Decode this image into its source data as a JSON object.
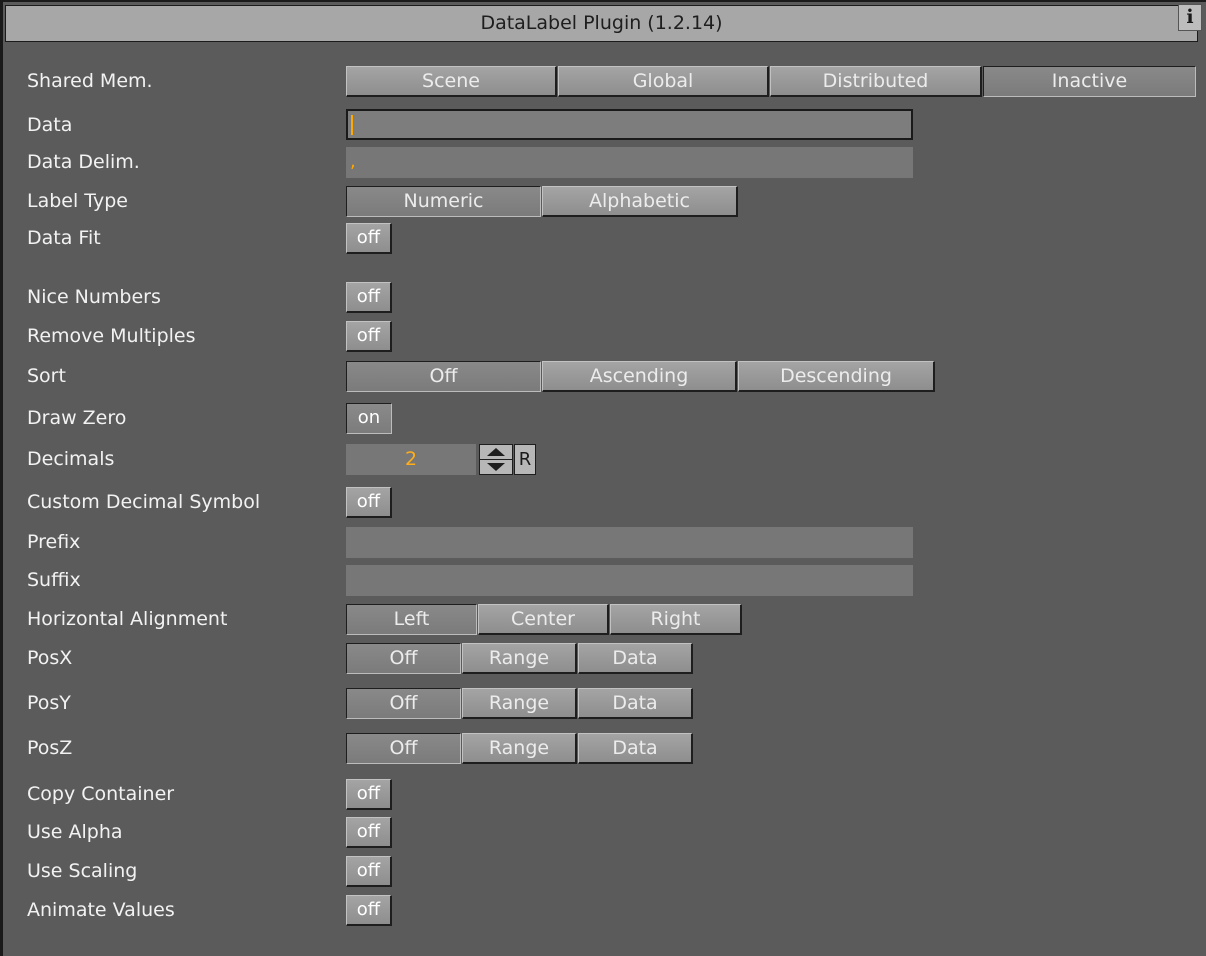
{
  "title": "DataLabel Plugin (1.2.14)",
  "info_icon": "info-icon",
  "info_glyph": "i",
  "shared_mem": {
    "label": "Shared Mem.",
    "options": [
      "Scene",
      "Global",
      "Distributed",
      "Inactive"
    ],
    "selected": "Inactive"
  },
  "data": {
    "label": "Data",
    "value": ""
  },
  "data_delim": {
    "label": "Data Delim.",
    "value": ","
  },
  "label_type": {
    "label": "Label Type",
    "options": [
      "Numeric",
      "Alphabetic"
    ],
    "selected": "Numeric"
  },
  "data_fit": {
    "label": "Data Fit",
    "value": "off"
  },
  "nice_numbers": {
    "label": "Nice Numbers",
    "value": "off"
  },
  "remove_multiples": {
    "label": "Remove Multiples",
    "value": "off"
  },
  "sort": {
    "label": "Sort",
    "options": [
      "Off",
      "Ascending",
      "Descending"
    ],
    "selected": "Off"
  },
  "draw_zero": {
    "label": "Draw Zero",
    "value": "on"
  },
  "decimals": {
    "label": "Decimals",
    "value": "2",
    "reset_label": "R"
  },
  "custom_decimal_symbol": {
    "label": "Custom Decimal Symbol",
    "value": "off"
  },
  "prefix": {
    "label": "Prefix",
    "value": ""
  },
  "suffix": {
    "label": "Suffix",
    "value": ""
  },
  "horizontal_alignment": {
    "label": "Horizontal Alignment",
    "options": [
      "Left",
      "Center",
      "Right"
    ],
    "selected": "Left"
  },
  "posx": {
    "label": "PosX",
    "options": [
      "Off",
      "Range",
      "Data"
    ],
    "selected": "Off"
  },
  "posy": {
    "label": "PosY",
    "options": [
      "Off",
      "Range",
      "Data"
    ],
    "selected": "Off"
  },
  "posz": {
    "label": "PosZ",
    "options": [
      "Off",
      "Range",
      "Data"
    ],
    "selected": "Off"
  },
  "copy_container": {
    "label": "Copy Container",
    "value": "off"
  },
  "use_alpha": {
    "label": "Use Alpha",
    "value": "off"
  },
  "use_scaling": {
    "label": "Use Scaling",
    "value": "off"
  },
  "animate_values": {
    "label": "Animate Values",
    "value": "off"
  }
}
